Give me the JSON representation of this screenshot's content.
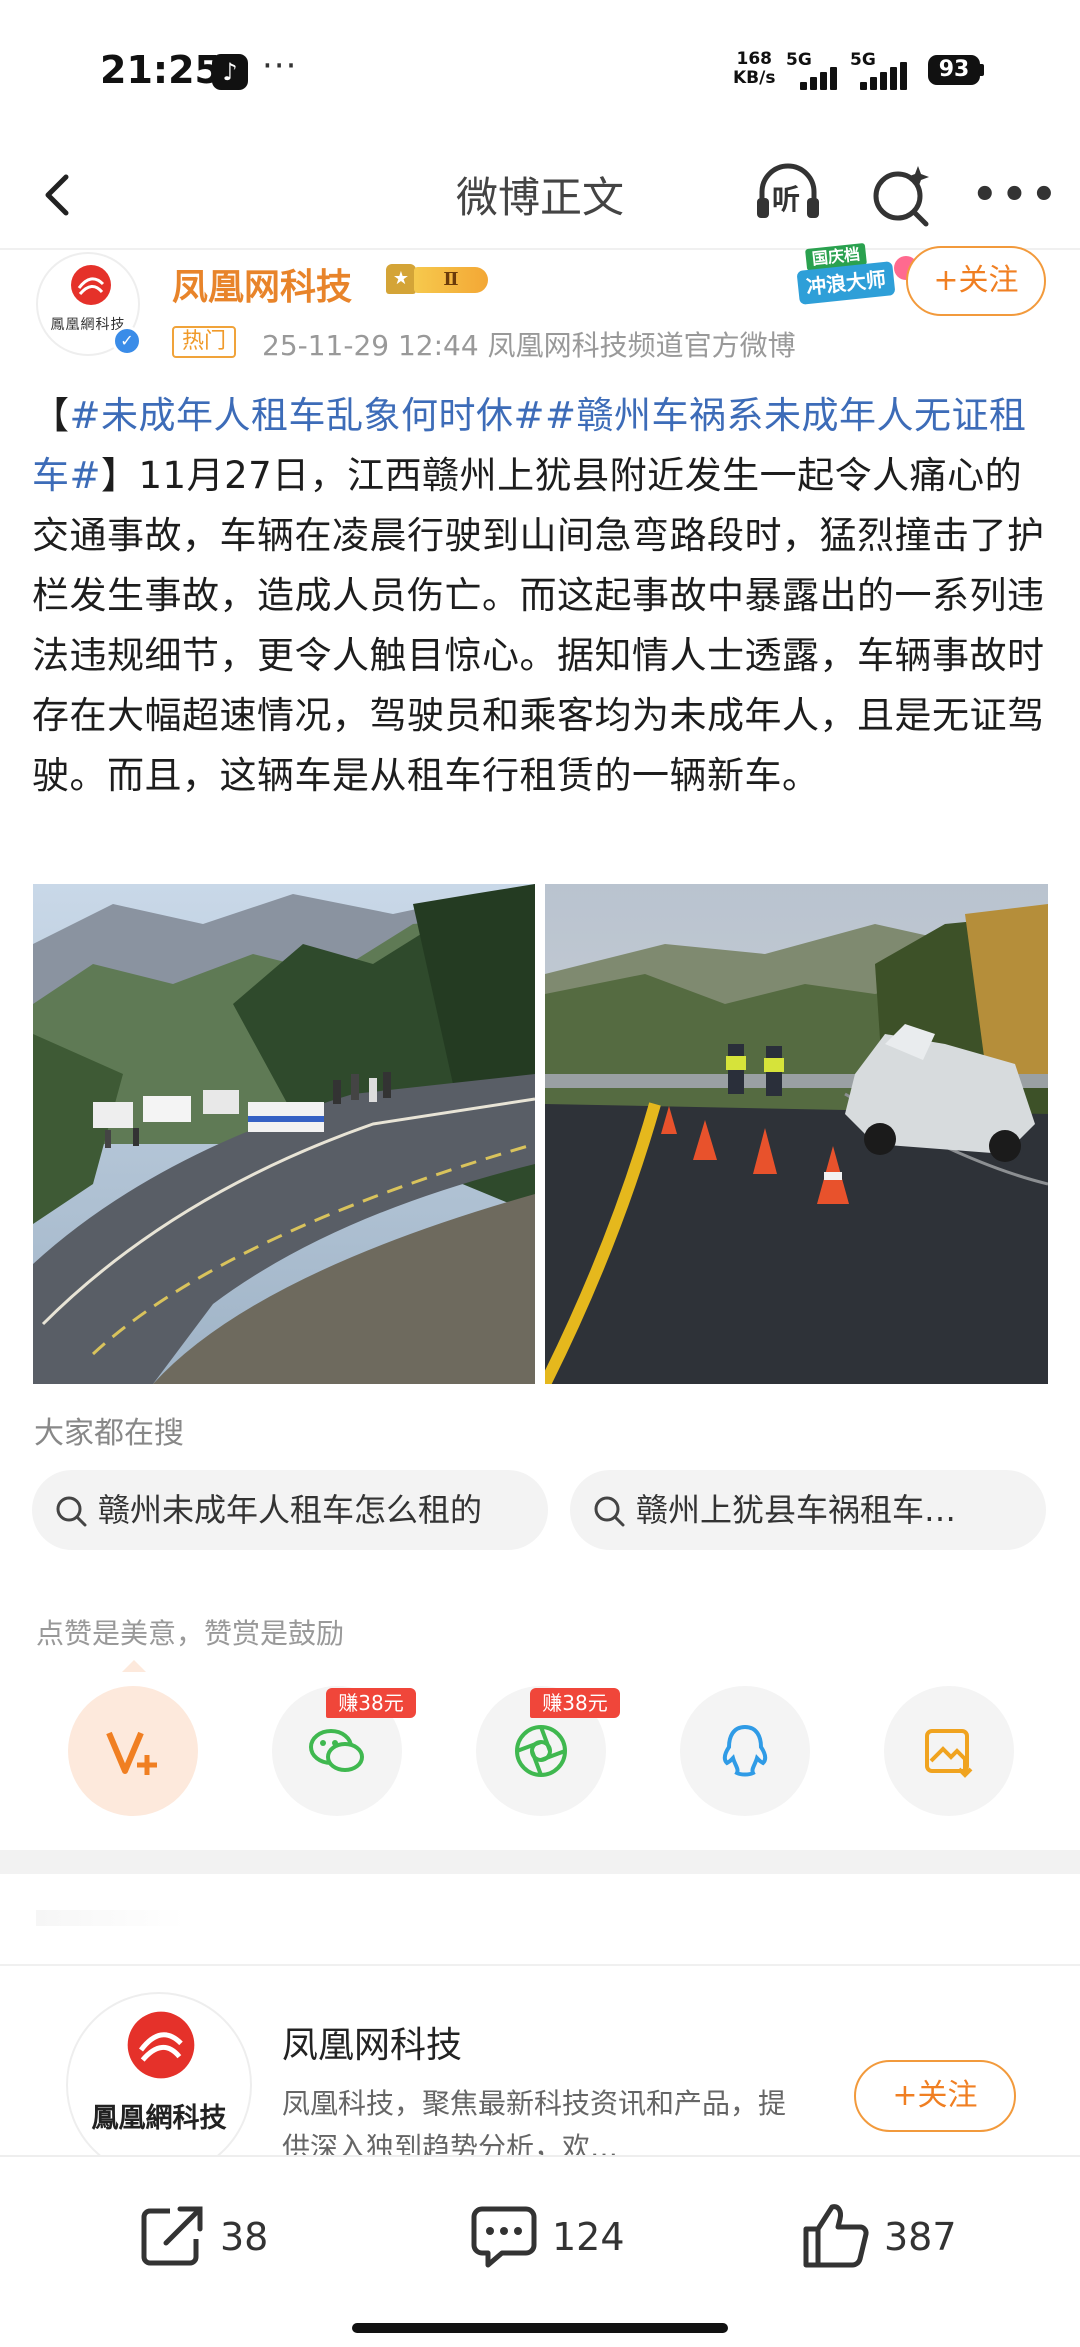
{
  "status_bar": {
    "time": "21:25",
    "notification_dots": "···",
    "net_speed_value": "168",
    "net_speed_unit": "KB/s",
    "signal_1_label": "5G",
    "signal_2_label": "5G",
    "battery_level": "93"
  },
  "nav": {
    "title": "微博正文",
    "listen_label": "听"
  },
  "post": {
    "author_name": "凤凰网科技",
    "level_badge": "Ⅱ",
    "hot_tag": "热门",
    "meta": "25-11-29 12:44  凤凰网科技频道官方微博",
    "surf_badge_line1": "国庆档",
    "surf_badge_line2": "冲浪大师",
    "follow_label": "+关注",
    "avatar_logo_text": "鳳凰網科技",
    "text_segments": [
      {
        "kind": "plain",
        "text": "【"
      },
      {
        "kind": "tag",
        "text": "#未成年人租车乱象何时休#"
      },
      {
        "kind": "tag",
        "text": "#赣州车祸系未成年人无证租车#"
      },
      {
        "kind": "plain",
        "text": "】11月27日，江西赣州上犹县附近发生一起令人痛心的交通事故，车辆在凌晨行驶到山间急弯路段时，猛烈撞击了护栏发生事故，造成人员伤亡。而这起事故中暴露出的一系列违法违规细节，更令人触目惊心。据知情人士透露，车辆事故时存在大幅超速情况，驾驶员和乘客均为未成年人，且是无证驾驶。而且，这辆车是从租车行租赁的一辆新车。"
      }
    ]
  },
  "search": {
    "heading": "大家都在搜",
    "chips": [
      "赣州未成年人租车怎么租的",
      "赣州上犹县车祸租车…"
    ]
  },
  "reward": {
    "heading": "点赞是美意，赞赏是鼓励",
    "earn_badge_1": "赚38元",
    "earn_badge_2": "赚38元"
  },
  "author_card": {
    "name": "凤凰网科技",
    "description": "凤凰科技，聚焦最新科技资讯和产品，提供深入独到趋势分析，欢…",
    "follow_label": "+关注",
    "avatar_logo_text": "鳳凰網科技"
  },
  "actions": {
    "repost_count": "38",
    "comment_count": "124",
    "like_count": "387"
  },
  "colors": {
    "accent_orange": "#f07f22",
    "tag_blue": "#3d6cb8",
    "earn_red": "#f0463a",
    "muted_gray": "#999999"
  },
  "icons": [
    "back-icon",
    "listen-icon",
    "search-sparkle-icon",
    "more-icon",
    "crown-icon",
    "verified-icon",
    "search-icon",
    "vplus-icon",
    "wechat-icon",
    "moments-icon",
    "qq-icon",
    "save-image-icon",
    "repost-icon",
    "comment-icon",
    "like-icon"
  ]
}
